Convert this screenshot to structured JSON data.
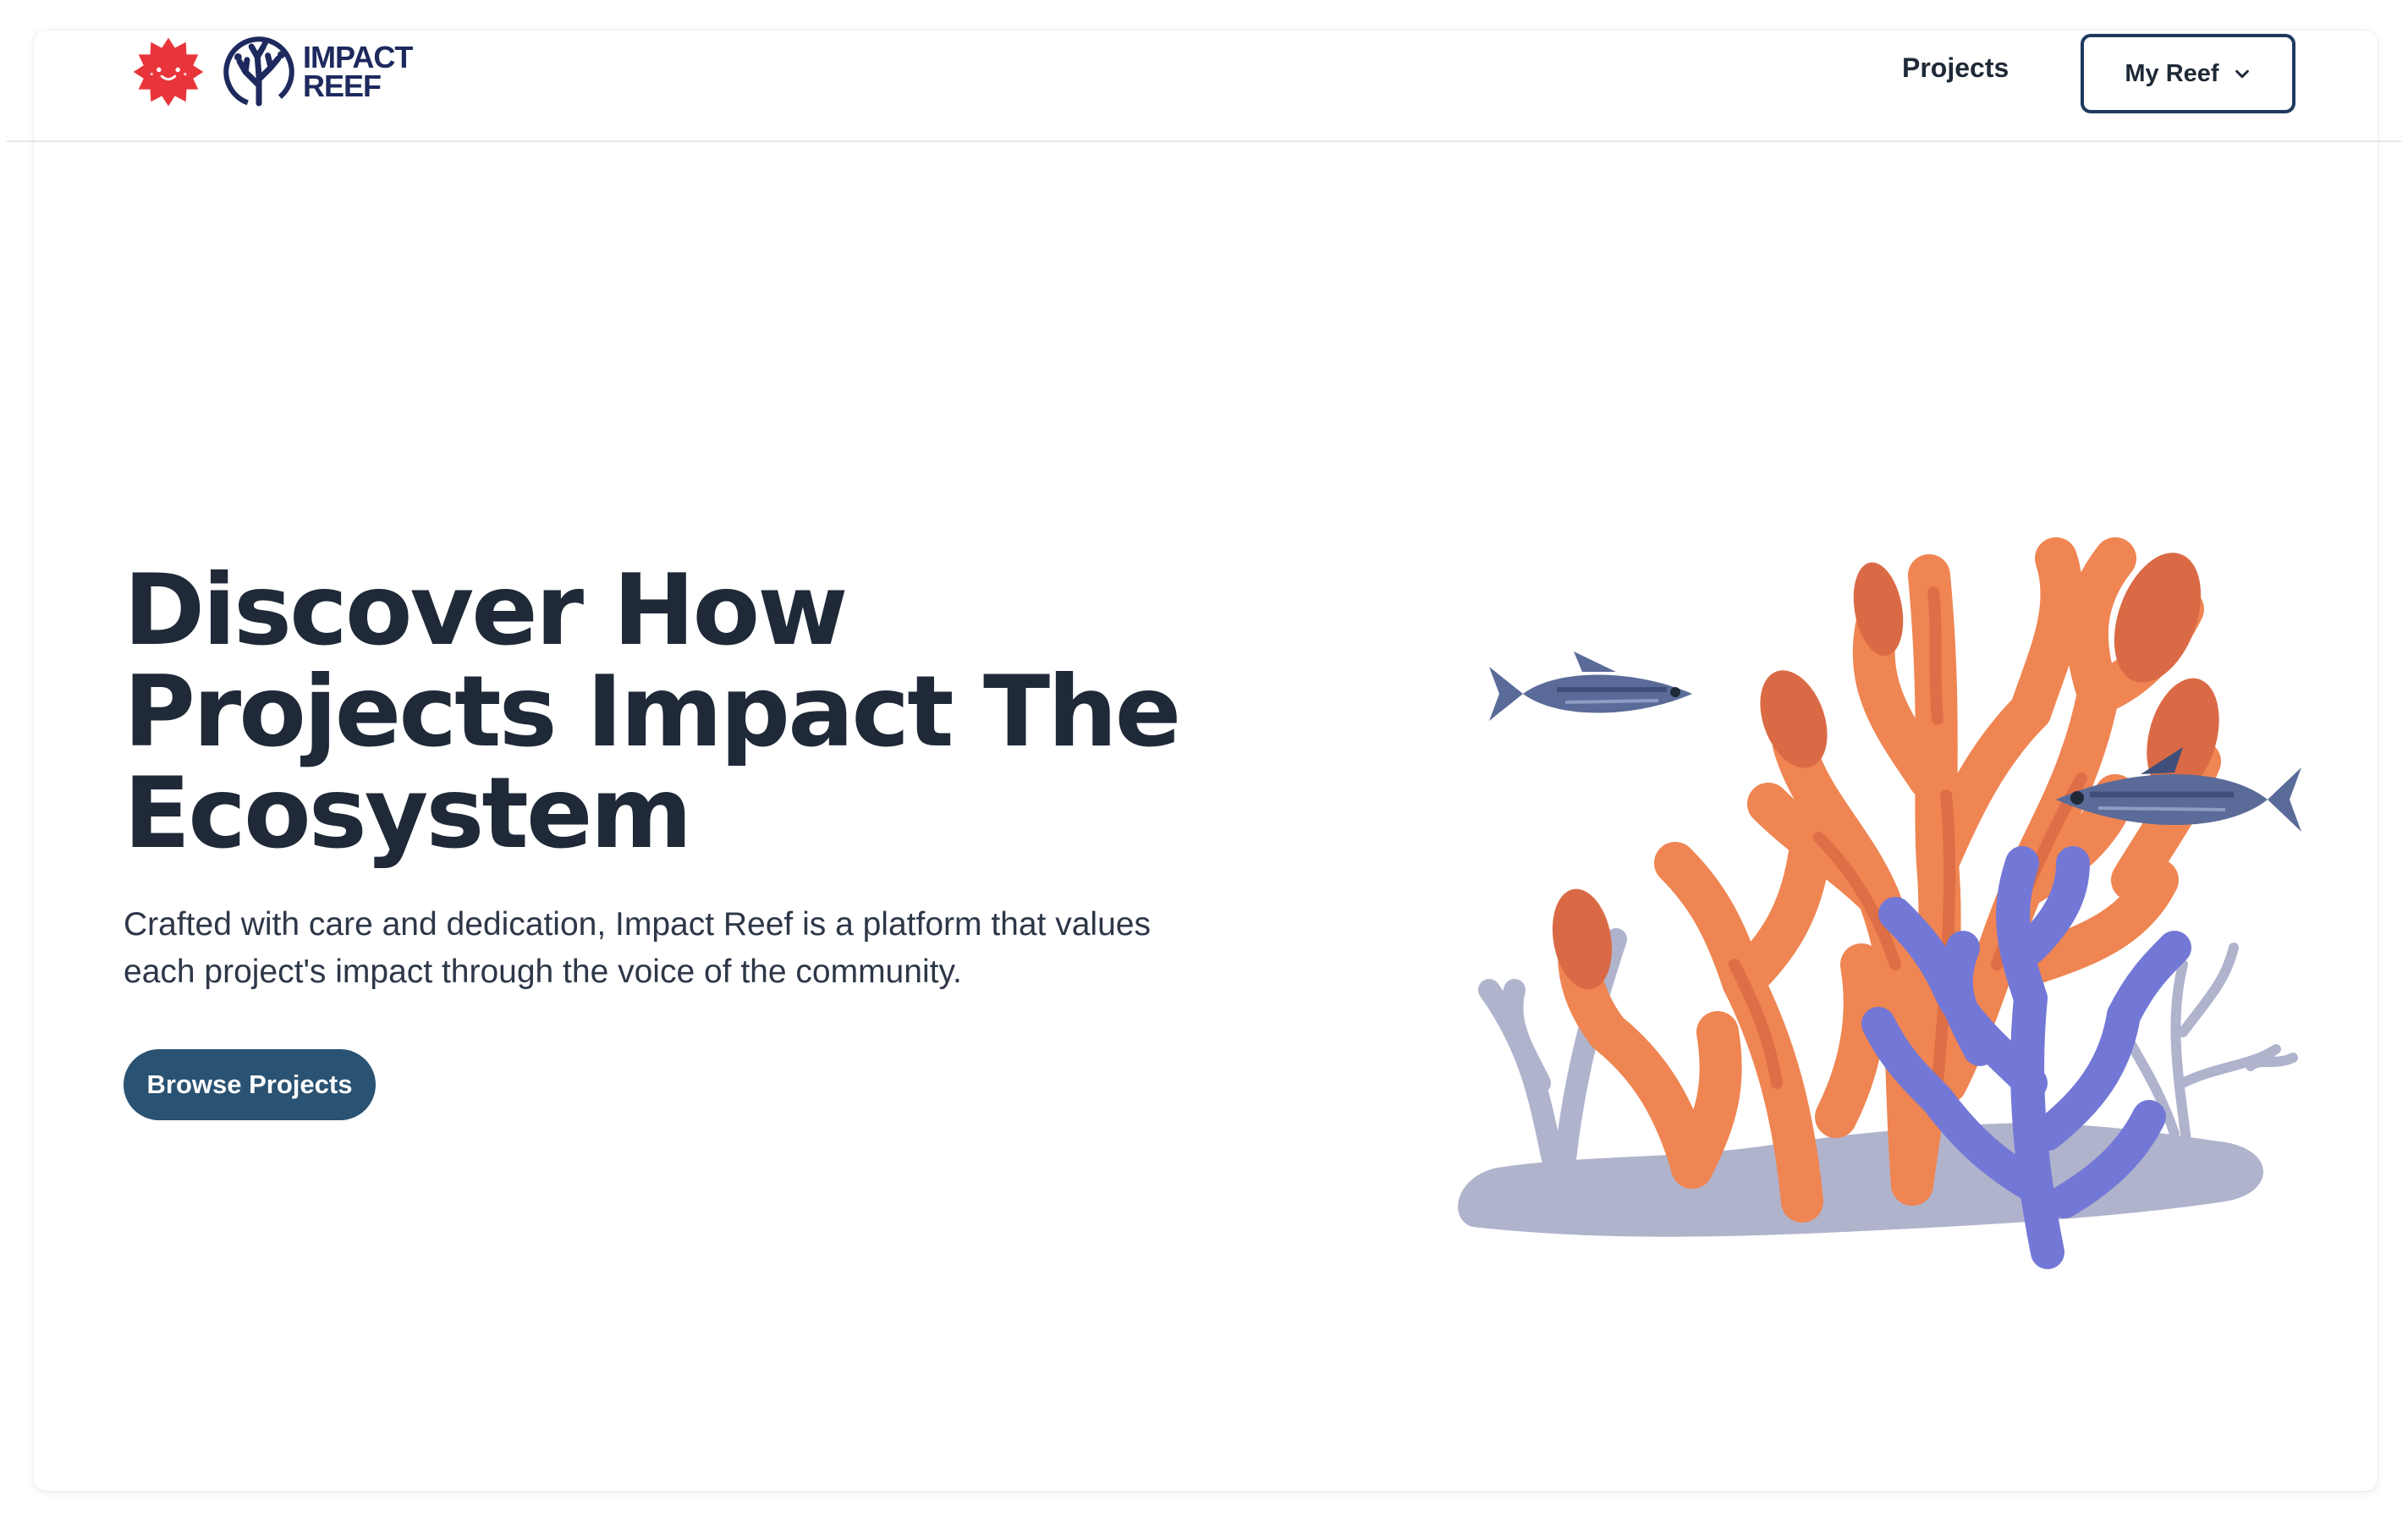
{
  "nav": {
    "brand_line1": "IMPACT",
    "brand_line2": "REEF",
    "projects_link": "Projects",
    "account_menu": "My Reef"
  },
  "hero": {
    "title_lines": [
      "Discover How",
      "Projects Impact The",
      "Ecosystem"
    ],
    "subtitle_lines": [
      "Crafted with care and dedication, Impact Reef is a platform that values",
      "each project's impact through the voice of the community."
    ],
    "cta_label": "Browse Projects"
  },
  "colors": {
    "primary": "#2a5272",
    "title": "#1f2937",
    "brand_navy": "#1e2a5e",
    "badge_red": "#e8343a",
    "coral_orange": "#ef8552",
    "coral_dark": "#da6a45",
    "coral_purple": "#7378d6",
    "seabed": "#b0b3cc",
    "fish": "#5a6b99"
  },
  "icons": {
    "badge": "sun-badge-icon",
    "brand": "coral-logo-icon",
    "dropdown": "chevron-down-icon"
  }
}
